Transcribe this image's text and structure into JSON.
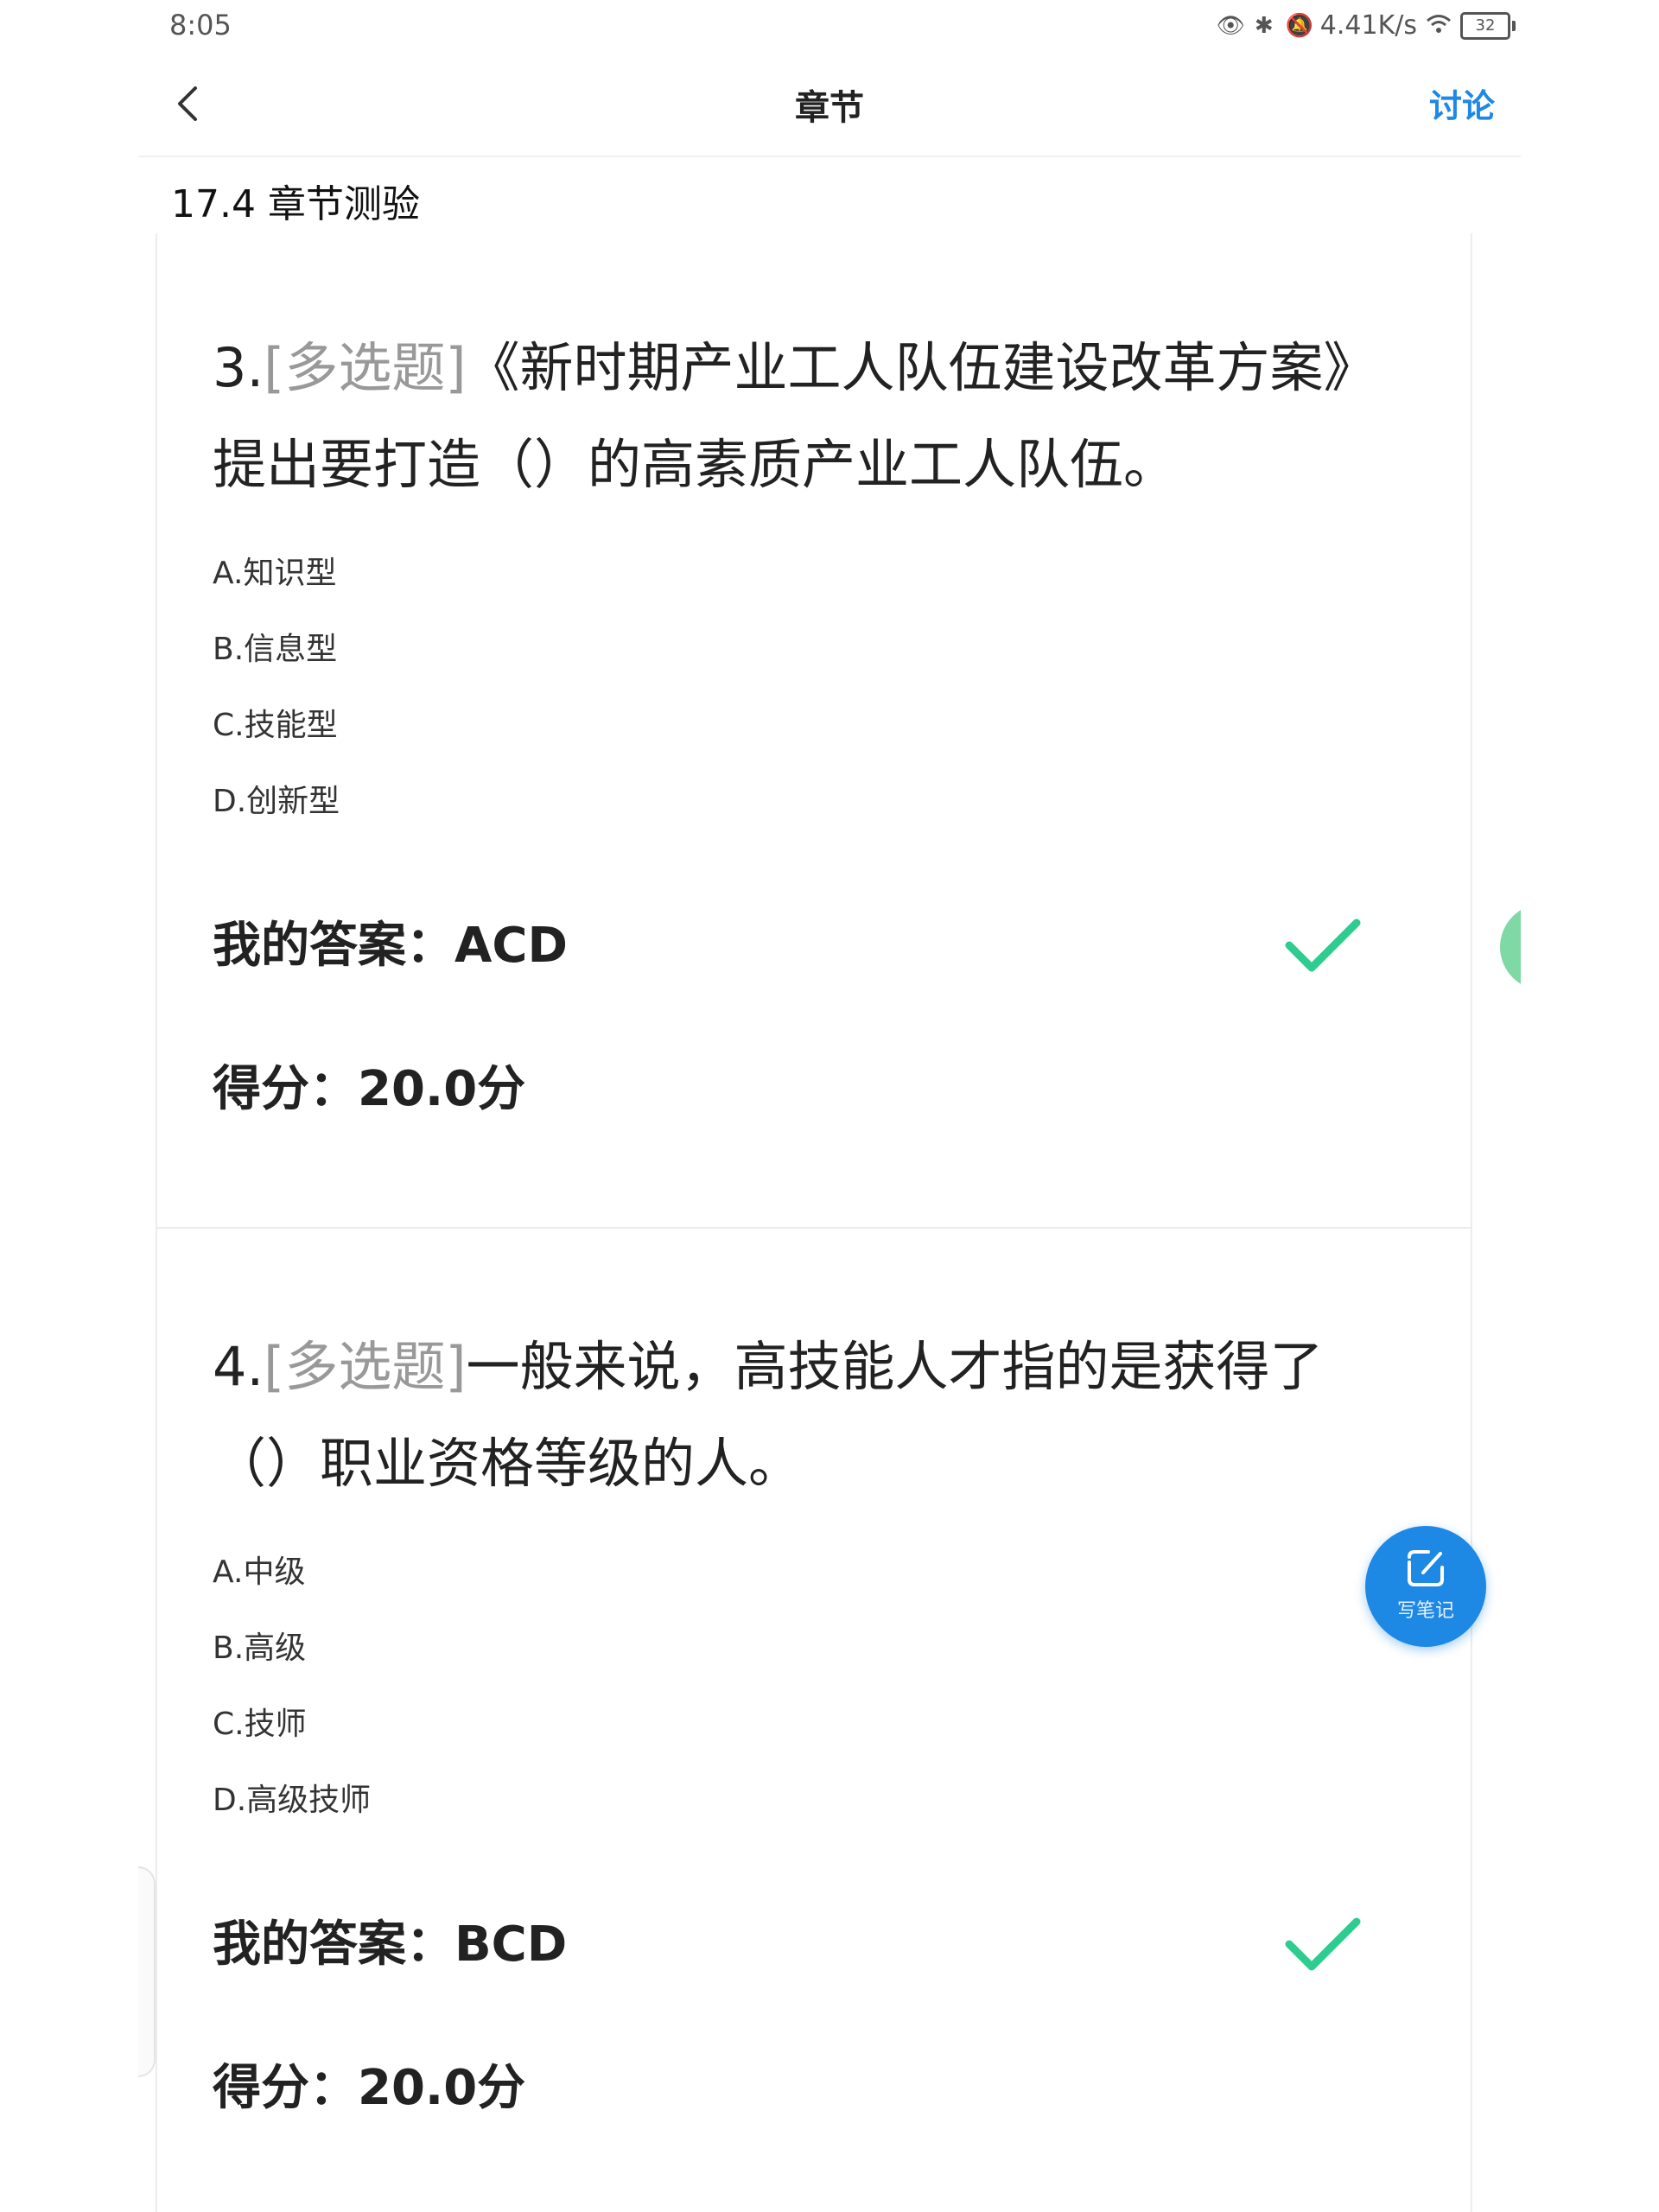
{
  "status_bar": {
    "time": "8:05",
    "net_speed": "4.41K/s",
    "battery": "32",
    "icons": [
      "eye-icon",
      "bluetooth-icon",
      "mute-icon",
      "wifi-icon",
      "battery-icon"
    ]
  },
  "nav": {
    "title": "章节",
    "discuss": "讨论"
  },
  "section": {
    "title": "17.4 章节测验"
  },
  "questions": [
    {
      "number": "3.",
      "type": "[多选题]",
      "text": "《新时期产业工人队伍建设改革方案》提出要打造（）的高素质产业工人队伍。",
      "options": [
        "A.知识型",
        "B.信息型",
        "C.技能型",
        "D.创新型"
      ],
      "answer": "我的答案：ACD",
      "score": "得分：20.0分"
    },
    {
      "number": "4.",
      "type": "[多选题]",
      "text": "一般来说，高技能人才指的是获得了（）职业资格等级的人。",
      "options": [
        "A.中级",
        "B.高级",
        "C.技师",
        "D.高级技师"
      ],
      "answer": "我的答案：BCD",
      "score": "得分：20.0分"
    }
  ],
  "note_button": {
    "label": "写笔记"
  },
  "colors": {
    "accent": "#1e88e5",
    "check": "#2ecc8f",
    "muted": "#999999"
  }
}
